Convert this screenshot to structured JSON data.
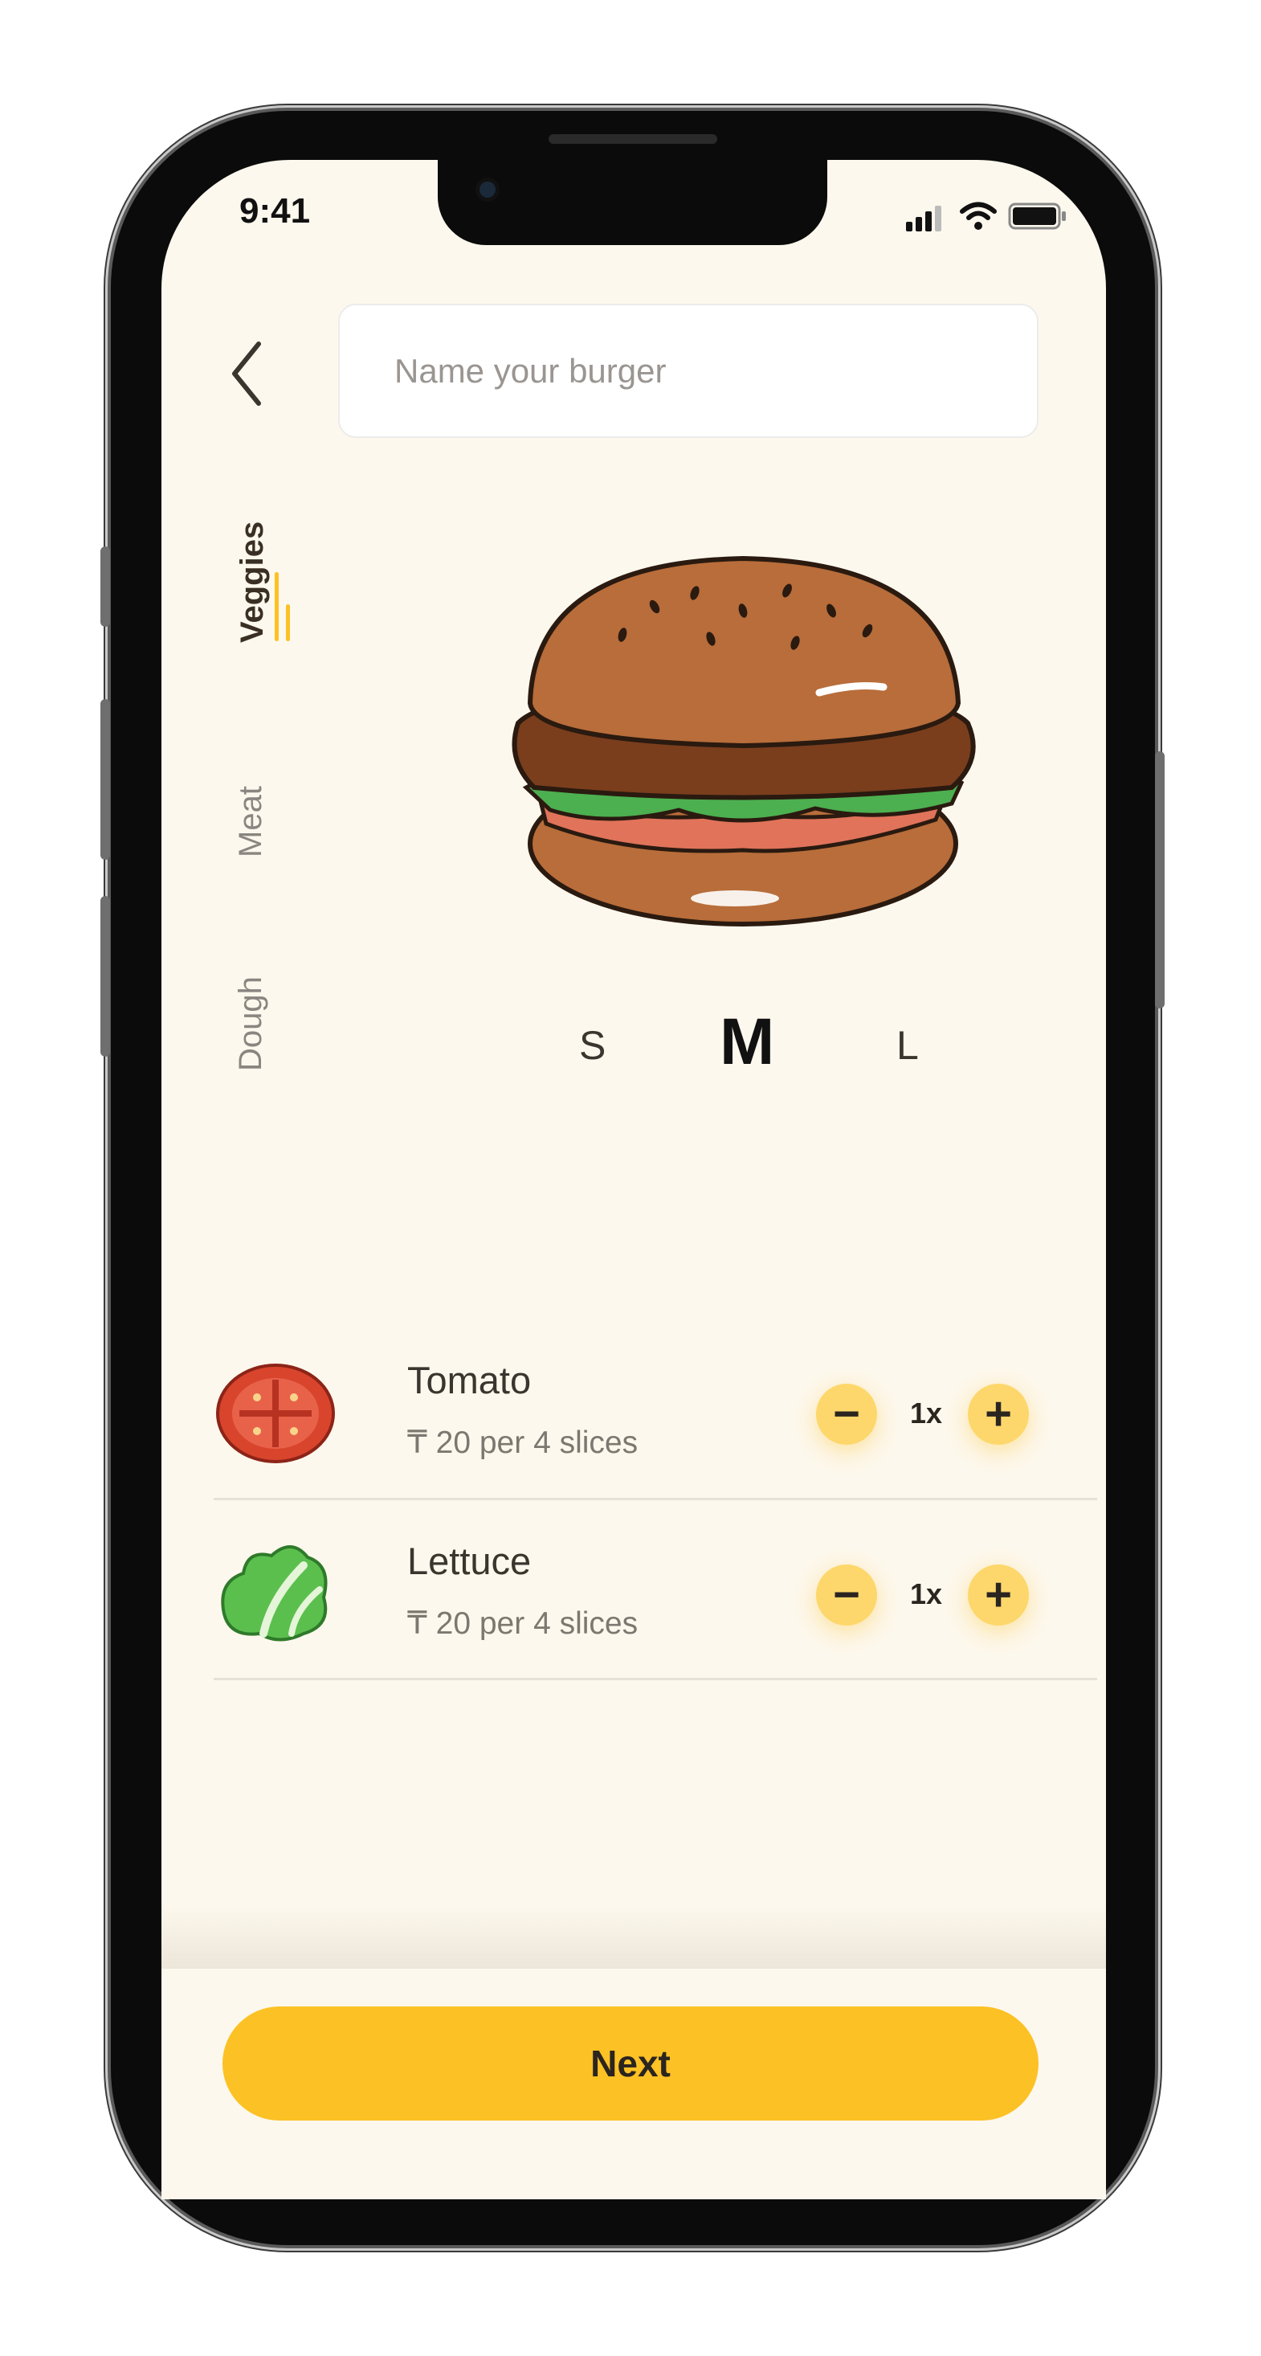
{
  "status_bar": {
    "time": "9:41",
    "icons": [
      "signal-icon",
      "wifi-icon",
      "battery-icon"
    ]
  },
  "header": {
    "back_icon": "chevron-left-icon",
    "name_placeholder": "Name your burger"
  },
  "categories": [
    {
      "label": "Veggies",
      "active": true
    },
    {
      "label": "Meat",
      "active": false
    },
    {
      "label": "Dough",
      "active": false
    }
  ],
  "preview_image": "burger-illustration",
  "sizes": [
    {
      "label": "S",
      "active": false
    },
    {
      "label": "M",
      "active": true
    },
    {
      "label": "L",
      "active": false
    }
  ],
  "ingredients": [
    {
      "name": "Tomato",
      "price": "₸ 20 per 4 slices",
      "quantity": "1x",
      "icon": "tomato-icon"
    },
    {
      "name": "Lettuce",
      "price": "₸ 20 per 4 slices",
      "quantity": "1x",
      "icon": "lettuce-icon"
    }
  ],
  "footer": {
    "next_label": "Next"
  },
  "colors": {
    "background": "#fdf8ed",
    "accent": "#fcc124",
    "accent_light": "#fdd76b",
    "text": "#3a352e"
  }
}
